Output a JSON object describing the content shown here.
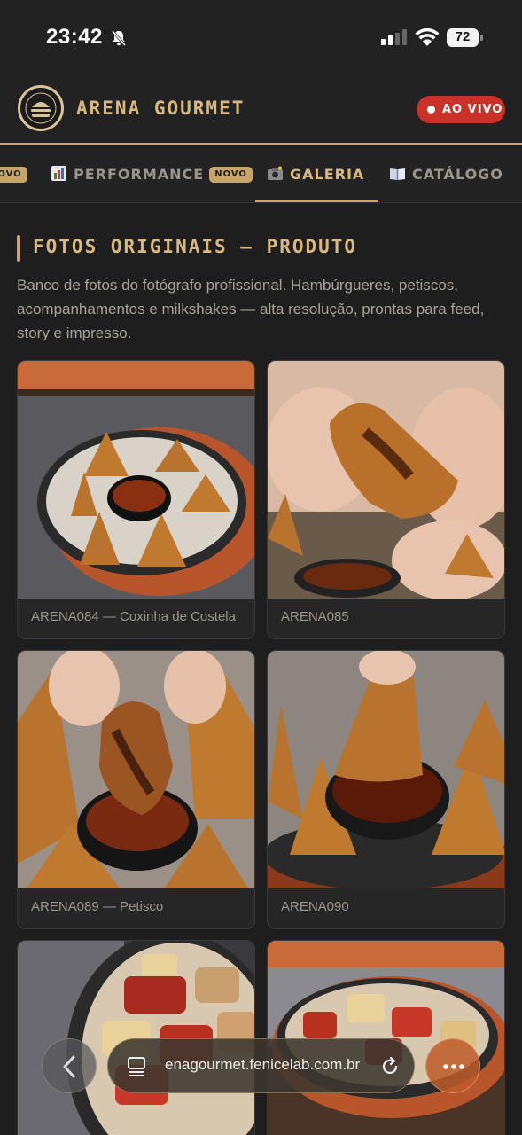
{
  "status_bar": {
    "time": "23:42",
    "battery": "72"
  },
  "header": {
    "brand": "ARENA GOURMET",
    "live_label": "AO VIVO"
  },
  "tabs": [
    {
      "label": "",
      "badge": "NOVO",
      "icon": "clipboard-icon"
    },
    {
      "label": "PERFORMANCE",
      "badge": "NOVO",
      "icon": "bar-chart-icon"
    },
    {
      "label": "GALERIA",
      "badge": "",
      "icon": "camera-icon",
      "active": true
    },
    {
      "label": "CATÁLOGO",
      "badge": "",
      "icon": "book-icon"
    }
  ],
  "section": {
    "title": "FOTOS ORIGINAIS — PRODUTO",
    "description": "Banco de fotos do fotógrafo profissional. Hambúrgueres, petiscos, acompanhamentos e milkshakes — alta resolução, prontas para feed, story e impresso."
  },
  "gallery": [
    {
      "caption": "ARENA084 — Coxinha de Costela"
    },
    {
      "caption": "ARENA085"
    },
    {
      "caption": "ARENA089 — Petisco"
    },
    {
      "caption": "ARENA090"
    },
    {
      "caption": ""
    },
    {
      "caption": ""
    }
  ],
  "browser": {
    "url": "enagourmet.fenicelab.com.br"
  },
  "colors": {
    "accent": "#c8a66c",
    "live": "#c83228",
    "background": "#1e1e1e"
  }
}
